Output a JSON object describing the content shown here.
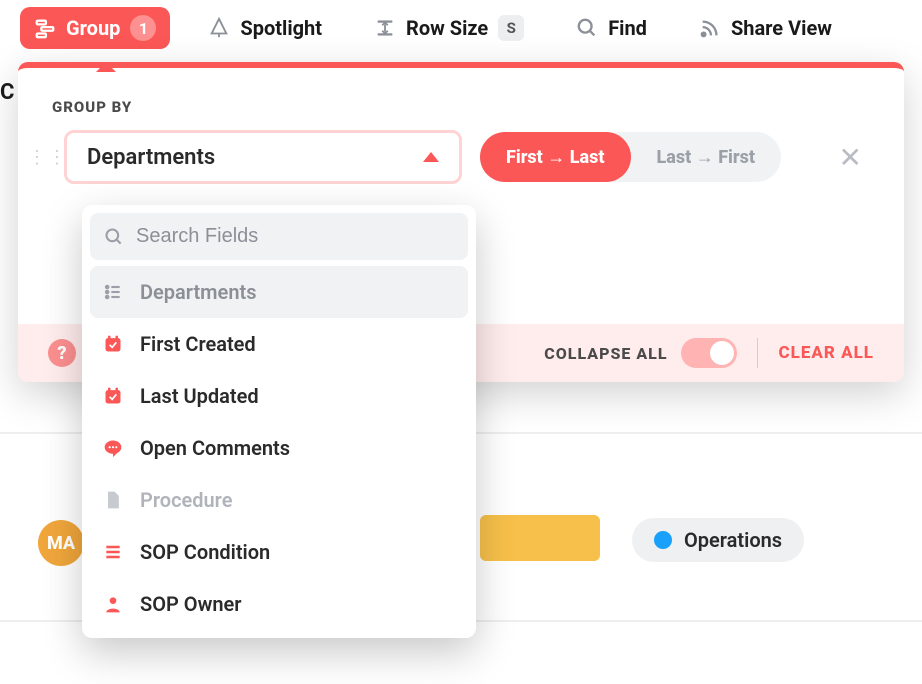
{
  "toolbar": {
    "group": {
      "label": "Group",
      "count": "1"
    },
    "spotlight": {
      "label": "Spotlight"
    },
    "rowsize": {
      "label": "Row Size",
      "key": "S"
    },
    "find": {
      "label": "Find"
    },
    "share": {
      "label": "Share View"
    }
  },
  "popover": {
    "section_label": "GROUP BY",
    "selected_field": "Departments",
    "sort": {
      "first_last": "First → Last",
      "last_first": "Last → First"
    },
    "footer": {
      "collapse_label": "COLLAPSE ALL",
      "clear_label": "CLEAR ALL"
    }
  },
  "dropdown": {
    "search_placeholder": "Search Fields",
    "items": [
      {
        "label": "Departments",
        "icon": "list",
        "state": "selected"
      },
      {
        "label": "First Created",
        "icon": "date",
        "state": "normal"
      },
      {
        "label": "Last Updated",
        "icon": "date",
        "state": "normal"
      },
      {
        "label": "Open Comments",
        "icon": "comment",
        "state": "normal"
      },
      {
        "label": "Procedure",
        "icon": "doc",
        "state": "disabled"
      },
      {
        "label": "SOP Condition",
        "icon": "lines",
        "state": "normal"
      },
      {
        "label": "SOP Owner",
        "icon": "person",
        "state": "normal"
      }
    ]
  },
  "background": {
    "left_crumb": "C",
    "avatar_initials": "MA",
    "tag_label": "Operations"
  },
  "colors": {
    "accent": "#fc5757"
  }
}
